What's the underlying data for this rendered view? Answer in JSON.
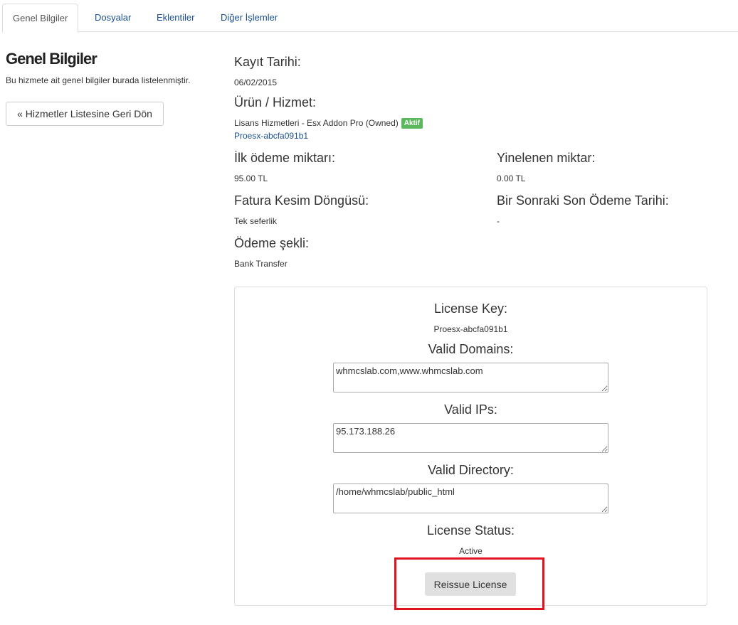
{
  "tabs": [
    {
      "label": "Genel Bilgiler"
    },
    {
      "label": "Dosyalar"
    },
    {
      "label": "Eklentiler"
    },
    {
      "label": "Diğer İşlemler"
    }
  ],
  "sidebar": {
    "title": "Genel Bilgiler",
    "description": "Bu hizmete ait genel bilgiler burada listelenmiştir.",
    "back_button": "« Hizmetler Listesine Geri Dön"
  },
  "info": {
    "registration_date_label": "Kayıt Tarihi:",
    "registration_date": "06/02/2015",
    "product_label": "Ürün / Hizmet:",
    "product_name": "Lisans Hizmetleri - Esx Addon Pro (Owned)",
    "status_badge": "Aktif",
    "product_domain": "Proesx-abcfa091b1",
    "first_payment_label": "İlk ödeme miktarı:",
    "first_payment": "95.00 TL",
    "recurring_label": "Yinelenen miktar:",
    "recurring": "0.00 TL",
    "billing_cycle_label": "Fatura Kesim Döngüsü:",
    "billing_cycle": "Tek seferlik",
    "next_due_label": "Bir Sonraki Son Ödeme Tarihi:",
    "next_due": "-",
    "payment_method_label": "Ödeme şekli:",
    "payment_method": "Bank Transfer"
  },
  "license": {
    "key_label": "License Key:",
    "key": "Proesx-abcfa091b1",
    "domains_label": "Valid Domains:",
    "domains": "whmcslab.com,www.whmcslab.com",
    "ips_label": "Valid IPs:",
    "ips": "95.173.188.26",
    "directory_label": "Valid Directory:",
    "directory": "/home/whmcslab/public_html",
    "status_label": "License Status:",
    "status": "Active",
    "reissue_button": "Reissue License"
  },
  "colors": {
    "link": "#1a4f8a",
    "badge_green": "#5cb85c",
    "highlight_red": "#e0141e"
  }
}
